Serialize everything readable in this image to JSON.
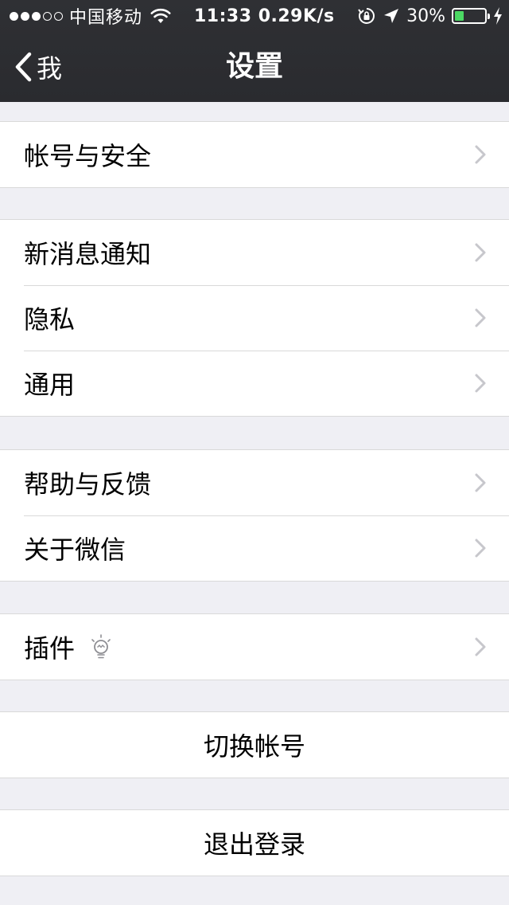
{
  "status_bar": {
    "signal": {
      "filled": 3,
      "total": 5
    },
    "carrier": "中国移动",
    "time_speed": "11:33 0.29K/s",
    "battery_percent_text": "30%",
    "battery_level": 0.3,
    "battery_color": "#4cd964"
  },
  "nav": {
    "back_label": "我",
    "title": "设置"
  },
  "groups": [
    {
      "items": [
        {
          "label": "帐号与安全"
        }
      ]
    },
    {
      "items": [
        {
          "label": "新消息通知"
        },
        {
          "label": "隐私"
        },
        {
          "label": "通用"
        }
      ]
    },
    {
      "items": [
        {
          "label": "帮助与反馈"
        },
        {
          "label": "关于微信"
        }
      ]
    },
    {
      "items": [
        {
          "label": "插件",
          "icon": "lightbulb-icon"
        }
      ]
    }
  ],
  "actions": {
    "switch_account": "切换帐号",
    "logout": "退出登录"
  },
  "colors": {
    "nav_background": "#2f3034",
    "page_background": "#efeff4",
    "separator": "#d9d9d9",
    "chevron": "#c7c7cc"
  },
  "icons": {
    "back": "chevron-left-icon",
    "disclosure": "chevron-right-icon",
    "wifi": "wifi-icon",
    "orientation_lock": "orientation-lock-icon",
    "location": "location-arrow-icon",
    "charging": "charging-bolt-icon"
  }
}
